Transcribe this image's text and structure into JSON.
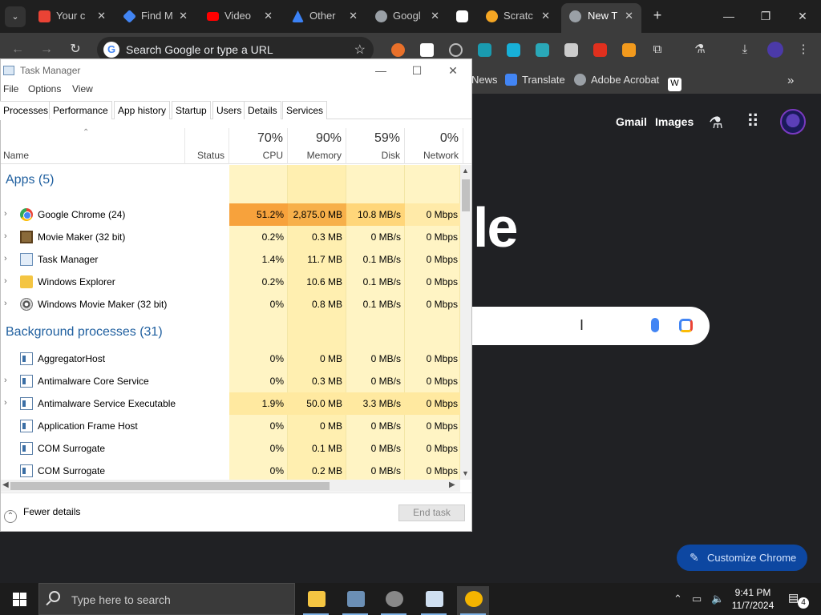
{
  "chrome": {
    "tabs": [
      {
        "title": "Your c",
        "icon": "gmail-icon",
        "color": "#ea4335"
      },
      {
        "title": "Find M",
        "icon": "gemini-icon",
        "color": "#4285f4"
      },
      {
        "title": "Video",
        "icon": "youtube-icon",
        "color": "#ff0000"
      },
      {
        "title": "Other",
        "icon": "drive-icon",
        "color": "#3b82f6"
      },
      {
        "title": "Googl",
        "icon": "chrome-icon",
        "color": "#9aa0a6"
      },
      {
        "title": "",
        "icon": "link-icon",
        "color": "#9aa0a6"
      },
      {
        "title": "Scratc",
        "icon": "scratch-icon",
        "color": "#f5a623"
      },
      {
        "title": "New T",
        "icon": "chrome-icon",
        "color": "#9aa0a6"
      }
    ],
    "new_tab": "+",
    "window_controls": {
      "minimize": "—",
      "restore": "❐",
      "close": "✕"
    },
    "omnibox": {
      "placeholder": "Search Google or type a URL"
    },
    "bookmarks": [
      {
        "label": "News",
        "icon": "news-icon"
      },
      {
        "label": "Translate",
        "icon": "translate-icon",
        "color": "#4285f4"
      },
      {
        "label": "Adobe Acrobat",
        "icon": "acrobat-icon",
        "color": "#9aa0a6"
      },
      {
        "label": "",
        "icon": "wikipedia-icon",
        "color": "#ffffff"
      }
    ],
    "ntp": {
      "gmail": "Gmail",
      "images": "Images",
      "logo_fragment": "le",
      "customize": "Customize Chrome"
    }
  },
  "task_manager": {
    "title": "Task Manager",
    "menu": [
      "File",
      "Options",
      "View"
    ],
    "tabs": [
      "Processes",
      "Performance",
      "App history",
      "Startup",
      "Users",
      "Details",
      "Services"
    ],
    "active_tab": "Processes",
    "columns": {
      "name": "Name",
      "status": "Status",
      "cpu": {
        "pct": "70%",
        "label": "CPU"
      },
      "memory": {
        "pct": "90%",
        "label": "Memory"
      },
      "disk": {
        "pct": "59%",
        "label": "Disk"
      },
      "network": {
        "pct": "0%",
        "label": "Network"
      }
    },
    "apps_group": "Apps (5)",
    "apps": [
      {
        "name": "Google Chrome (24)",
        "cpu": "51.2%",
        "memory": "2,875.0 MB",
        "disk": "10.8 MB/s",
        "network": "0 Mbps"
      },
      {
        "name": "Movie Maker (32 bit)",
        "cpu": "0.2%",
        "memory": "0.3 MB",
        "disk": "0 MB/s",
        "network": "0 Mbps"
      },
      {
        "name": "Task Manager",
        "cpu": "1.4%",
        "memory": "11.7 MB",
        "disk": "0.1 MB/s",
        "network": "0 Mbps"
      },
      {
        "name": "Windows Explorer",
        "cpu": "0.2%",
        "memory": "10.6 MB",
        "disk": "0.1 MB/s",
        "network": "0 Mbps"
      },
      {
        "name": "Windows Movie Maker (32 bit)",
        "cpu": "0%",
        "memory": "0.8 MB",
        "disk": "0.1 MB/s",
        "network": "0 Mbps"
      }
    ],
    "bg_group": "Background processes (31)",
    "background": [
      {
        "name": "AggregatorHost",
        "cpu": "0%",
        "memory": "0 MB",
        "disk": "0 MB/s",
        "network": "0 Mbps"
      },
      {
        "name": "Antimalware Core Service",
        "cpu": "0%",
        "memory": "0.3 MB",
        "disk": "0 MB/s",
        "network": "0 Mbps"
      },
      {
        "name": "Antimalware Service Executable",
        "cpu": "1.9%",
        "memory": "50.0 MB",
        "disk": "3.3 MB/s",
        "network": "0 Mbps"
      },
      {
        "name": "Application Frame Host",
        "cpu": "0%",
        "memory": "0 MB",
        "disk": "0 MB/s",
        "network": "0 Mbps"
      },
      {
        "name": "COM Surrogate",
        "cpu": "0%",
        "memory": "0.1 MB",
        "disk": "0 MB/s",
        "network": "0 Mbps"
      },
      {
        "name": "COM Surrogate",
        "cpu": "0%",
        "memory": "0.2 MB",
        "disk": "0 MB/s",
        "network": "0 Mbps"
      }
    ],
    "fewer_details": "Fewer details",
    "end_task": "End task"
  },
  "taskbar": {
    "search_placeholder": "Type here to search",
    "time": "9:41 PM",
    "date": "11/7/2024",
    "notification_count": "4"
  }
}
